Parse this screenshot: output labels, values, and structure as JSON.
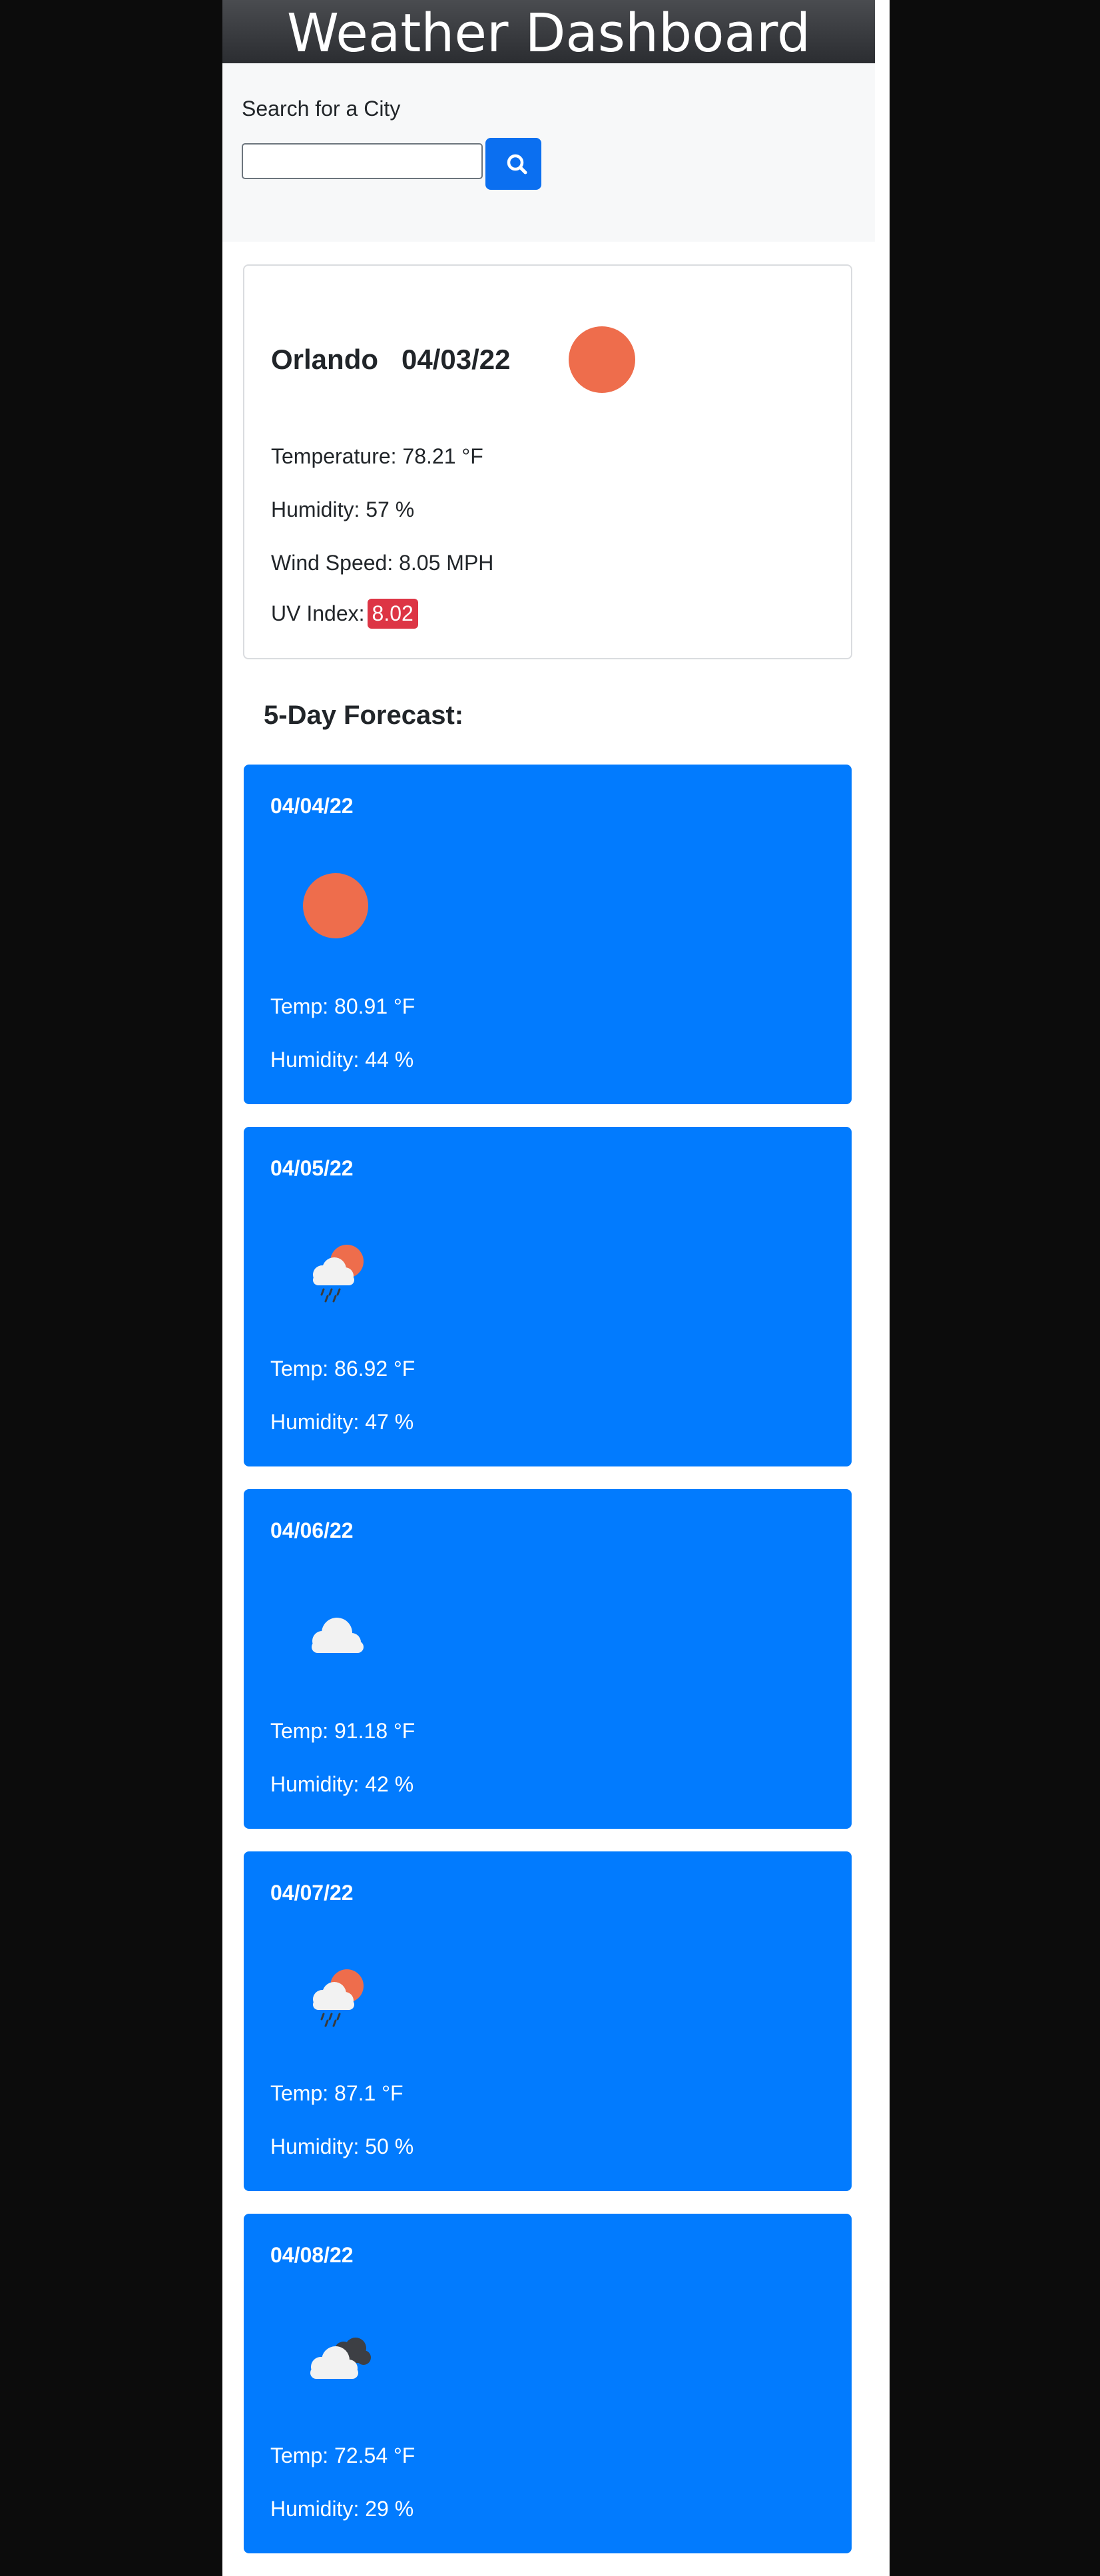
{
  "header": {
    "title": "Weather Dashboard"
  },
  "search": {
    "label": "Search for a City",
    "value": "",
    "placeholder": "",
    "button_icon": "search-icon"
  },
  "current": {
    "city": "Orlando",
    "date": "04/03/22",
    "icon": "sun-icon",
    "temperature": "Temperature: 78.21 °F",
    "humidity": "Humidity: 57 %",
    "wind": "Wind Speed: 8.05 MPH",
    "uv_label": "UV Index:",
    "uv_value": "8.02",
    "uv_color": "#dd3545"
  },
  "forecast": {
    "heading": "5-Day Forecast:",
    "days": [
      {
        "date": "04/04/22",
        "icon": "sun-icon",
        "temp": "Temp: 80.91 °F",
        "humidity": "Humidity: 44 %"
      },
      {
        "date": "04/05/22",
        "icon": "sun-rain-cloud-icon",
        "temp": "Temp: 86.92 °F",
        "humidity": "Humidity: 47 %"
      },
      {
        "date": "04/06/22",
        "icon": "cloud-icon",
        "temp": "Temp: 91.18 °F",
        "humidity": "Humidity: 42 %"
      },
      {
        "date": "04/07/22",
        "icon": "sun-rain-cloud-icon",
        "temp": "Temp: 87.1 °F",
        "humidity": "Humidity: 50 %"
      },
      {
        "date": "04/08/22",
        "icon": "broken-clouds-icon",
        "temp": "Temp: 72.54 °F",
        "humidity": "Humidity: 29 %"
      }
    ]
  },
  "colors": {
    "accent": "#027bfe",
    "button": "#0b6ff0",
    "sun": "#ee6d4c",
    "uv_high": "#dd3545"
  }
}
